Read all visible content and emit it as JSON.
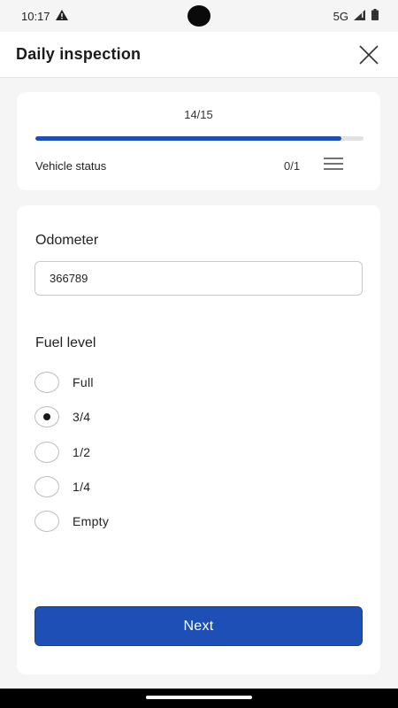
{
  "status_bar": {
    "time": "10:17",
    "network": "5G"
  },
  "header": {
    "title": "Daily inspection"
  },
  "progress": {
    "count_label": "14/15",
    "fraction": 0.933,
    "section_name": "Vehicle status",
    "section_count": "0/1"
  },
  "form": {
    "odometer": {
      "label": "Odometer",
      "value": "366789"
    },
    "fuel_level": {
      "label": "Fuel level",
      "options": [
        "Full",
        "3/4",
        "1/2",
        "1/4",
        "Empty"
      ],
      "selected": "3/4"
    },
    "next_label": "Next"
  },
  "colors": {
    "accent": "#1e4fb7",
    "background": "#f5f5f5",
    "card": "#ffffff"
  },
  "icons": [
    "warning-icon",
    "signal-icon",
    "battery-icon",
    "close-icon",
    "menu-icon"
  ]
}
